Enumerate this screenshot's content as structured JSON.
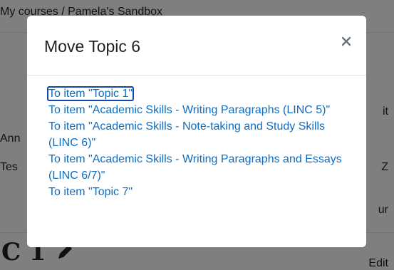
{
  "background": {
    "breadcrumb": "My courses  /  Pamela's Sandbox",
    "left_fragments": [
      "Ann",
      "Tes"
    ],
    "right_fragments": [
      "it",
      "Z",
      "ur"
    ],
    "big_text": "C 1",
    "edit_link": "Edit"
  },
  "modal": {
    "title": "Move Topic 6",
    "close_label": "×",
    "items": [
      {
        "label": "To item \"Topic 1\""
      },
      {
        "label": "To item \"Academic Skills - Writing Paragraphs (LINC 5)\""
      },
      {
        "label": "To item \"Academic Skills - Note-taking and Study Skills (LINC 6)\""
      },
      {
        "label": "To item \"Academic Skills - Writing Paragraphs and Essays (LINC 6/7)\""
      },
      {
        "label": "To item \"Topic 7\""
      }
    ]
  },
  "colors": {
    "link": "#0f6cbf",
    "focus_ring": "#0f47ad",
    "backdrop": "rgba(0,0,0,0.5)"
  },
  "icons": {
    "close": "close-icon",
    "edit": "pencil-icon"
  }
}
